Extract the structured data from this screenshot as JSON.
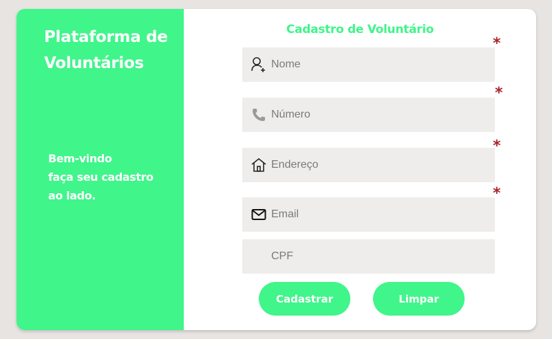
{
  "sidebar": {
    "title_line1": "Plataforma de",
    "title_line2": "Voluntários",
    "welcome_line1": "Bem-vindo",
    "welcome_line2": "faça seu cadastro",
    "welcome_line3": "ao lado."
  },
  "form": {
    "title": "Cadastro de Voluntário",
    "required_mark": "*",
    "fields": [
      {
        "placeholder": "Nome",
        "icon": "user-add-icon",
        "required": true
      },
      {
        "placeholder": "Número",
        "icon": "phone-icon",
        "required": true
      },
      {
        "placeholder": "Endereço",
        "icon": "home-icon",
        "required": true
      },
      {
        "placeholder": "Email",
        "icon": "mail-icon",
        "required": true
      },
      {
        "placeholder": "CPF",
        "icon": "",
        "required": false
      }
    ],
    "buttons": {
      "submit_label": "Cadastrar",
      "clear_label": "Limpar"
    }
  },
  "colors": {
    "accent": "#40f58a",
    "required": "#a8262c",
    "field_bg": "#efedeb",
    "page_bg": "#e8e4e2"
  }
}
